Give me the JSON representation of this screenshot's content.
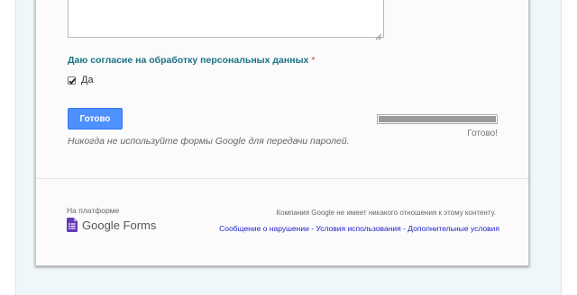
{
  "form": {
    "question_title": "Даю согласие на обработку персональных данных",
    "required_mark": "*",
    "option_label": "Да",
    "option_checked": true,
    "submit_label": "Готово",
    "password_warning": "Никогда не используйте формы Google для передачи паролей.",
    "progress_fraction": 1.0,
    "progress_label": "Готово!"
  },
  "footer": {
    "platform_label": "На платформе",
    "logo_word_google": "Google",
    "logo_word_forms": "Forms",
    "disclaimer": "Компания Google не имеет никакого отношения к этому контенту.",
    "links": [
      "Сообщение о нарушении",
      "Условия использования",
      "Дополнительные условия"
    ],
    "link_separator": " - "
  },
  "colors": {
    "accent": "#1b7384",
    "submit_button": "#4d90fe",
    "required": "#d23f31",
    "forms_purple": "#673ab7",
    "link": "#2222cc"
  },
  "icons": {
    "checkbox": "check-icon",
    "logo": "google-forms-icon",
    "resize": "resize-handle-icon"
  }
}
